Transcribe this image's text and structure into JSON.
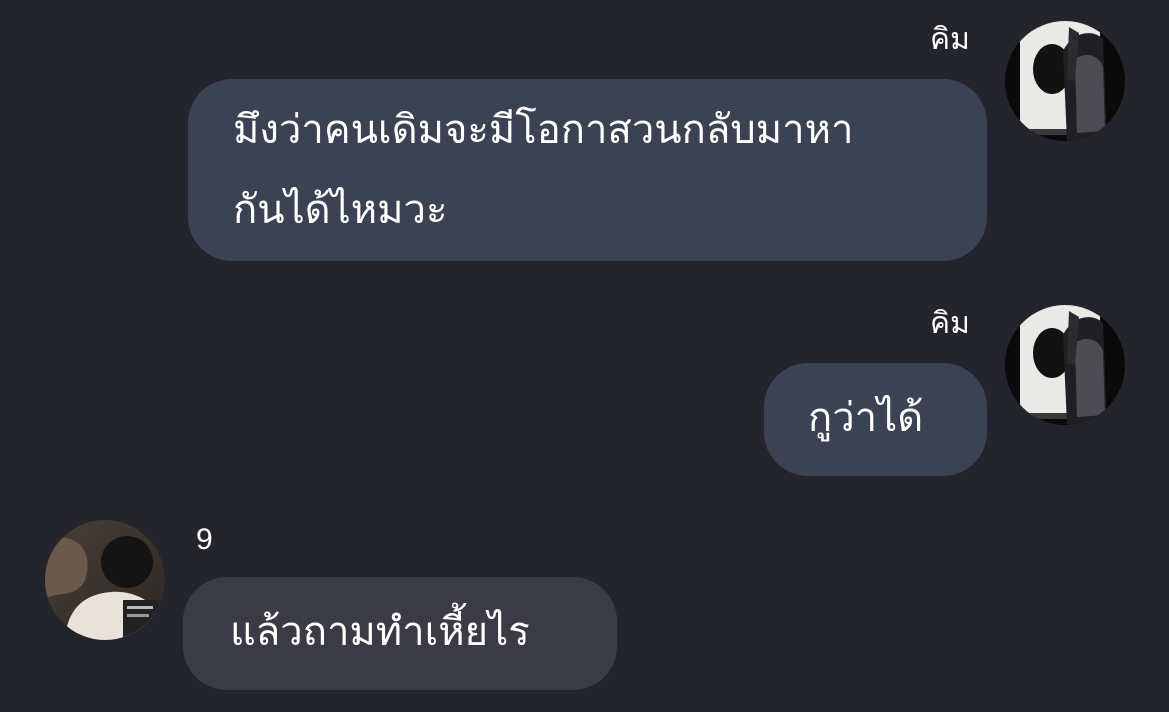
{
  "messages": [
    {
      "direction": "outgoing",
      "sender": "คิม",
      "lines": [
        "มึงว่าคนเดิมจะมีโอกาสวนกลับมาหา",
        "กันได้ไหมวะ"
      ]
    },
    {
      "direction": "outgoing",
      "sender": "คิม",
      "lines": [
        "กูว่าได้"
      ]
    },
    {
      "direction": "incoming",
      "sender": "9",
      "lines": [
        "แล้วถามทำเหี้ยไร"
      ]
    }
  ],
  "colors": {
    "background": "#24242c",
    "outgoing_bubble": "#3a4253",
    "incoming_bubble": "#3b3b45",
    "text": "#ffffff"
  }
}
